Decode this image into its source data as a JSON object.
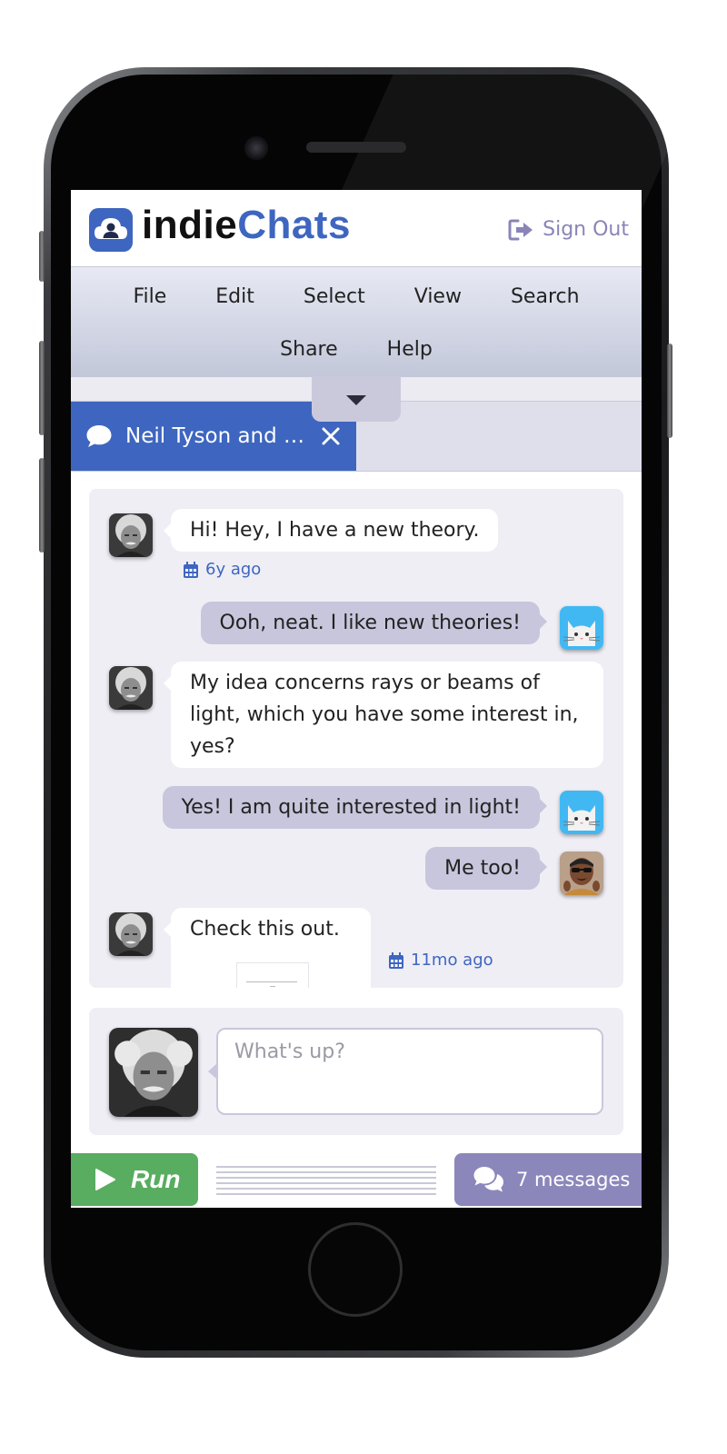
{
  "app": {
    "logo_part1": "indie",
    "logo_part2": "Chats",
    "sign_out": "Sign Out",
    "brand_color": "#3e66c0"
  },
  "menu": {
    "row1": [
      "File",
      "Edit",
      "Select",
      "View",
      "Search"
    ],
    "row2": [
      "Share",
      "Help"
    ]
  },
  "tab": {
    "title": "Neil Tyson and …"
  },
  "messages": [
    {
      "side": "left",
      "text": "Hi!   Hey, I have a new theory.",
      "avatar": "einstein",
      "meta": "6y ago"
    },
    {
      "side": "right",
      "text": "Ooh, neat.   I like new theories!",
      "avatar": "cat"
    },
    {
      "side": "left",
      "text": "My idea concerns rays or beams of light, which you have some interest in, yes?",
      "avatar": "einstein"
    },
    {
      "side": "right",
      "text": "Yes!  I am quite interested in light!",
      "avatar": "cat"
    },
    {
      "side": "right",
      "text": "Me too!",
      "avatar": "tyson"
    },
    {
      "side": "left",
      "text": "Check this out.",
      "avatar": "einstein",
      "meta": "11mo ago"
    }
  ],
  "compose": {
    "placeholder": "What's up?"
  },
  "footer": {
    "run_label": "Run",
    "messages_label": "7 messages",
    "run_color": "#58ad60",
    "messages_color": "#8b87bb"
  }
}
